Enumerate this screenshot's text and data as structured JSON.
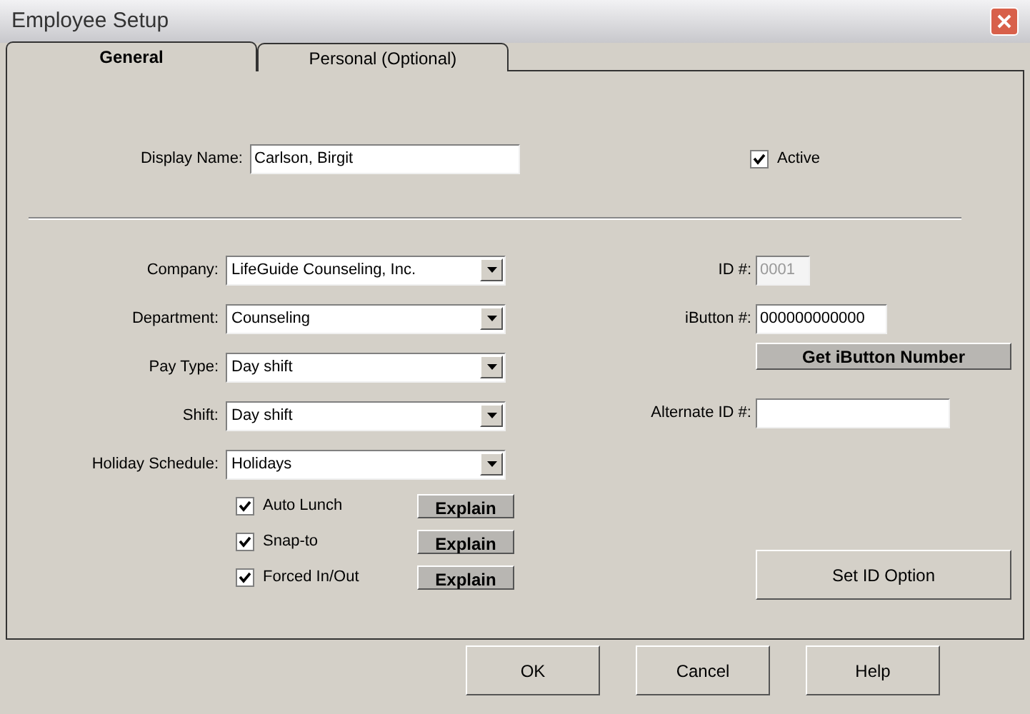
{
  "window": {
    "title": "Employee Setup"
  },
  "tabs": [
    {
      "label": "General",
      "selected": true
    },
    {
      "label": "Personal (Optional)",
      "selected": false
    }
  ],
  "display_name": {
    "label": "Display Name:",
    "value": "Carlson, Birgit"
  },
  "active": {
    "label": "Active",
    "checked": true
  },
  "dropdowns": [
    {
      "label": "Company:",
      "value": "LifeGuide Counseling, Inc."
    },
    {
      "label": "Department:",
      "value": "Counseling"
    },
    {
      "label": "Pay Type:",
      "value": "Day shift"
    },
    {
      "label": "Shift:",
      "value": "Day shift"
    },
    {
      "label": "Holiday Schedule:",
      "value": "Holidays"
    }
  ],
  "options": [
    {
      "label": "Auto Lunch",
      "checked": true,
      "button": "Explain"
    },
    {
      "label": "Snap-to",
      "checked": true,
      "button": "Explain"
    },
    {
      "label": "Forced In/Out",
      "checked": true,
      "button": "Explain"
    }
  ],
  "id": {
    "label": "ID #:",
    "value": "0001",
    "disabled": true
  },
  "ibutton": {
    "label": "iButton #:",
    "value": "000000000000",
    "button": "Get iButton Number"
  },
  "alternate_id": {
    "label": "Alternate ID #:"
  },
  "set_id_button": "Set ID Option",
  "buttons": [
    "OK",
    "Cancel",
    "Help"
  ]
}
